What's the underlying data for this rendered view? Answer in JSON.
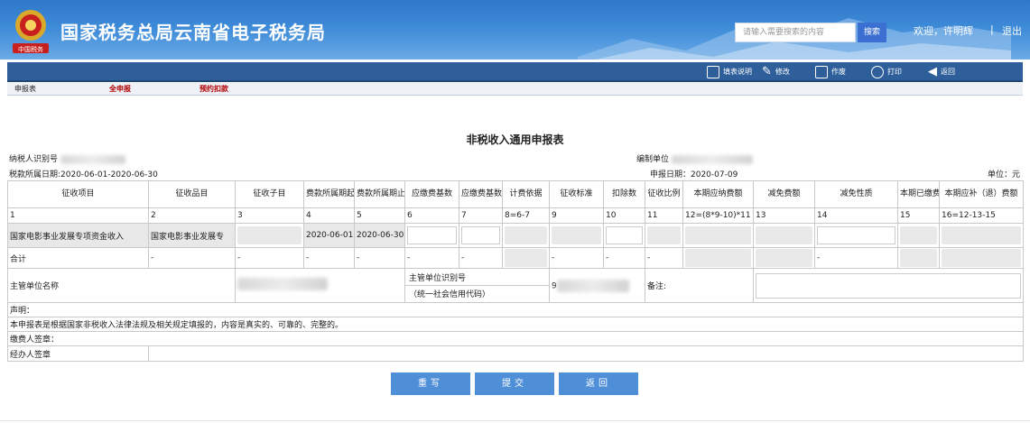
{
  "header": {
    "emblem_text": "中国税务",
    "title": "国家税务总局云南省电子税务局",
    "search_placeholder": "请输入需要搜索的内容",
    "search_button": "搜索",
    "welcome": "欢迎，许明辉",
    "separator": "|",
    "logout": "退出"
  },
  "toolbar": {
    "items": [
      {
        "label": "填表说明",
        "icon": "document-icon"
      },
      {
        "label": "修改",
        "icon": "pencil-icon"
      },
      {
        "label": "作废",
        "icon": "void-icon"
      },
      {
        "label": "打印",
        "icon": "printer-icon"
      },
      {
        "label": "返回",
        "icon": "back-arrow-icon"
      }
    ]
  },
  "tabs": [
    "申报表",
    "全申报",
    "预约扣款"
  ],
  "form": {
    "title": "非税收入通用申报表",
    "taxpayer_id_label": "纳税人识别号",
    "period_label": "税款所属日期:2020-06-01-2020-06-30",
    "org_label": "编制单位",
    "report_date_label": "申报日期：2020-07-09",
    "unit_label": "单位：元"
  },
  "table": {
    "headers": [
      "征收项目",
      "征收品目",
      "征收子目",
      "费款所属期起",
      "费款所属期止",
      "应缴费基数",
      "应缴费基数减除额",
      "计费依据",
      "征收标准",
      "扣除数",
      "征收比例",
      "本期应纳费额",
      "减免费额",
      "减免性质",
      "本期已缴费额",
      "本期应补（退）费额"
    ],
    "index_row": [
      "1",
      "2",
      "3",
      "4",
      "5",
      "6",
      "7",
      "8=6-7",
      "9",
      "10",
      "11",
      "12=(8*9-10)*11",
      "13",
      "14",
      "15",
      "16=12-13-15"
    ],
    "data_row": {
      "item": "国家电影事业发展专项资金收入",
      "subitem": "国家电影事业发展专",
      "start": "2020-06-01",
      "end": "2020-06-30"
    },
    "total_label": "合计",
    "dash": "-",
    "authority_name_label": "主管单位名称",
    "authority_id_label": "主管单位识别号",
    "credit_code_label": "（统一社会信用代码）",
    "authority_id_prefix": "9",
    "remark_label": "备注:",
    "declaration_label": "声明：",
    "declaration_text": "本申报表是根据国家非税收入法律法规及相关规定填报的，内容是真实的、可靠的、完整的。",
    "payer_sign_label": "缴费人签章：",
    "handler_sign_label": "经办人签章"
  },
  "buttons": {
    "rewrite": "重写",
    "submit": "提交",
    "back": "返回"
  },
  "colors": {
    "header_blue": "#3d8ad8",
    "toolbar_blue": "#2e5f9a",
    "button_blue": "#4f8fd8",
    "tab_red": "#b00000"
  }
}
